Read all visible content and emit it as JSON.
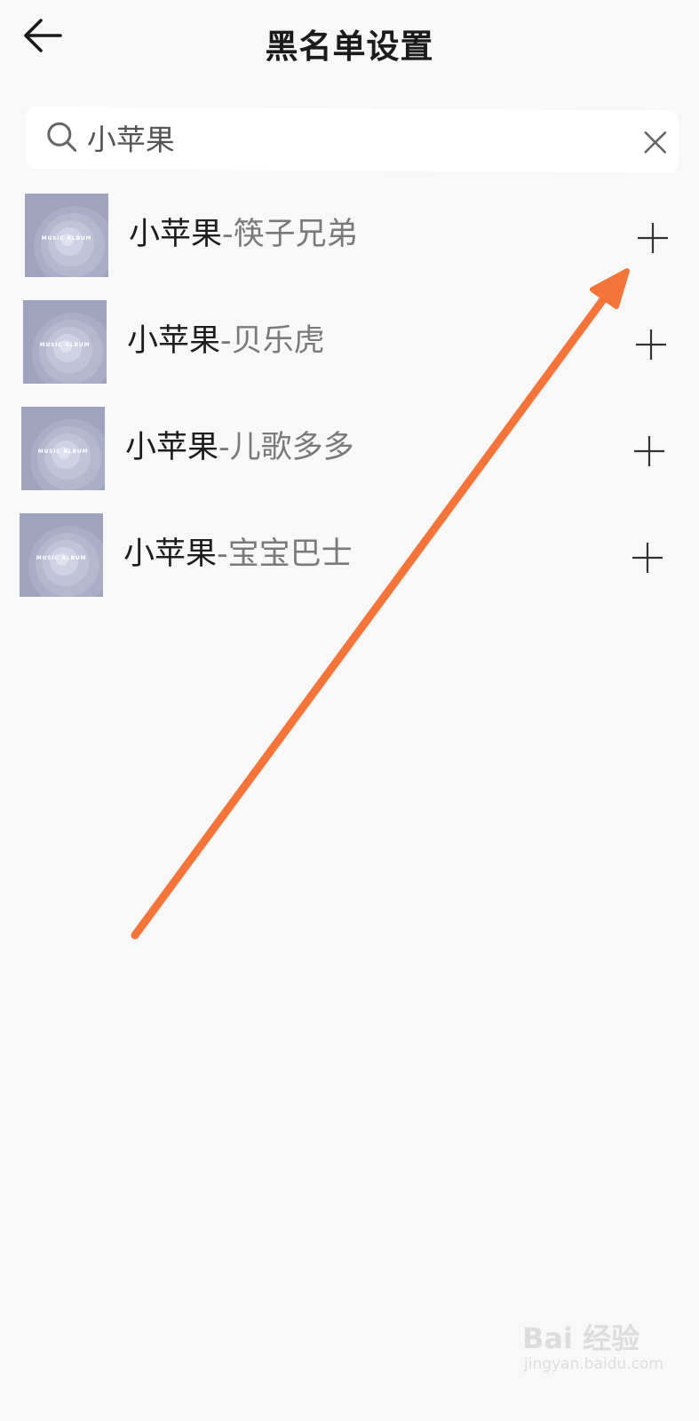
{
  "header": {
    "title": "黑名单设置",
    "back_icon": "arrow-left-icon"
  },
  "search": {
    "value": "小苹果",
    "search_icon": "search-icon",
    "clear_icon": "close-icon"
  },
  "results": [
    {
      "artist": "小苹果",
      "song": "-筷子兄弟",
      "cover_text": "MUSIC ALBUM"
    },
    {
      "artist": "小苹果",
      "song": "-贝乐虎",
      "cover_text": "MUSIC ALBUM"
    },
    {
      "artist": "小苹果",
      "song": "-儿歌多多",
      "cover_text": "MUSIC ALBUM"
    },
    {
      "artist": "小苹果",
      "song": "-宝宝巴士",
      "cover_text": "MUSIC ALBUM"
    }
  ],
  "annotation": {
    "arrow_color": "#f5743a"
  },
  "watermark": {
    "brand": "Bai 经验",
    "url": "jingyan.baidu.com"
  },
  "colors": {
    "background": "#f8f8f8",
    "album_cover": "#9fa3bd",
    "artist_text": "#1d1d1d",
    "song_text": "#7a7a7a"
  }
}
